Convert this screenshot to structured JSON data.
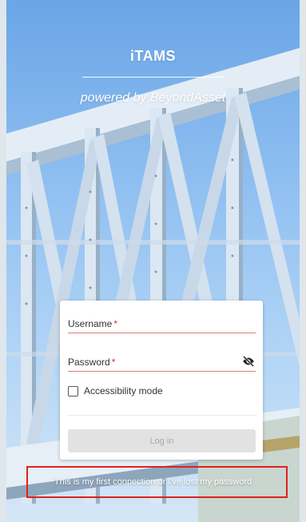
{
  "header": {
    "app_title": "iTAMS",
    "tagline": "powered by BeyondAsset"
  },
  "login_form": {
    "username": {
      "label": "Username",
      "required_marker": "*",
      "value": ""
    },
    "password": {
      "label": "Password",
      "required_marker": "*",
      "value": "",
      "toggle_icon": "eye-off-icon"
    },
    "accessibility": {
      "label": "Accessibility mode",
      "checked": false
    },
    "login_button": {
      "label": "Log in",
      "enabled": false
    }
  },
  "footer": {
    "first_connection_link": "This is my first connection or I've lost my password"
  },
  "colors": {
    "sky": "#8fbff1",
    "steel": "#d8e6f2",
    "underline": "#e07b7b",
    "required": "#d32f2f",
    "button_disabled": "#e2e2e2",
    "highlight": "#e0211d"
  }
}
